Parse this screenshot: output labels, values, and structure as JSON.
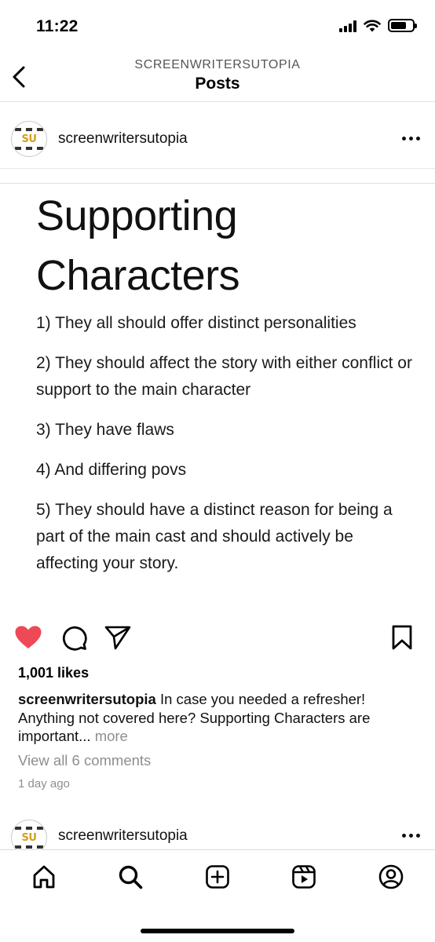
{
  "status_bar": {
    "time": "11:22"
  },
  "header": {
    "subtitle": "SCREENWRITERSUTOPIA",
    "title": "Posts"
  },
  "post": {
    "username": "screenwritersutopia",
    "avatar_text": "SU",
    "image": {
      "title_lines": [
        "Supporting",
        "Characters"
      ],
      "points": [
        "1) They all should offer distinct personalities",
        "2) They should affect the story with either conflict or support to the main character",
        "3) They have flaws",
        "4) And differing povs",
        "5) They should have a distinct reason for being a part of the main cast and should actively be affecting your story."
      ]
    },
    "liked": true,
    "likes_text": "1,001 likes",
    "caption_user": "screenwritersutopia",
    "caption_text": "In case you needed a refresher! Anything not covered here? Supporting Characters are important...",
    "caption_more": "more",
    "view_comments": "View all 6 comments",
    "timestamp": "1 day ago"
  },
  "next_post": {
    "username": "screenwritersutopia",
    "avatar_text": "SU"
  },
  "icons": {
    "back": "chevron-left-icon",
    "more": "more-horizontal-icon",
    "like": "heart-icon",
    "comment": "comment-icon",
    "share": "send-icon",
    "save": "bookmark-icon",
    "nav": [
      "home-icon",
      "search-icon",
      "add-post-icon",
      "reels-icon",
      "profile-icon"
    ]
  },
  "colors": {
    "like": "#ed4956",
    "secondary_text": "#8e8e8e",
    "avatar_accent": "#d4a017"
  }
}
